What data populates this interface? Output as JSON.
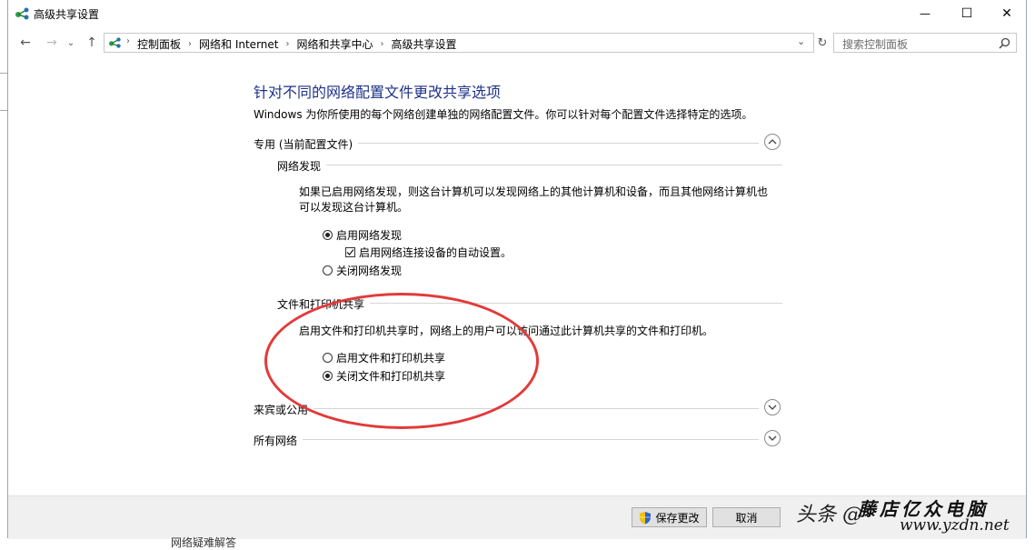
{
  "window": {
    "title": "高级共享设置",
    "minimize_glyph": "—",
    "maximize_glyph": "☐",
    "close_glyph": "✕"
  },
  "nav": {
    "back_glyph": "←",
    "forward_glyph": "→",
    "recent_glyph": "⌄",
    "up_glyph": "↑"
  },
  "address": {
    "crumbs": [
      "控制面板",
      "网络和 Internet",
      "网络和共享中心",
      "高级共享设置"
    ],
    "separator": "›"
  },
  "search": {
    "placeholder": "搜索控制面板"
  },
  "content": {
    "heading": "针对不同的网络配置文件更改共享选项",
    "description": "Windows 为你所使用的每个网络创建单独的网络配置文件。你可以针对每个配置文件选择特定的选项。",
    "sections": {
      "private": {
        "label": "专用 (当前配置文件)",
        "expanded": true,
        "network_discovery": {
          "label": "网络发现",
          "paragraph": "如果已启用网络发现，则这台计算机可以发现网络上的其他计算机和设备，而且其他网络计算机也可以发现这台计算机。",
          "options": {
            "on": "启用网络发现",
            "auto_setup": "启用网络连接设备的自动设置。",
            "off": "关闭网络发现"
          },
          "selected": "on",
          "auto_setup_checked": true
        },
        "file_printer_sharing": {
          "label": "文件和打印机共享",
          "paragraph": "启用文件和打印机共享时，网络上的用户可以访问通过此计算机共享的文件和打印机。",
          "options": {
            "on": "启用文件和打印机共享",
            "off": "关闭文件和打印机共享"
          },
          "selected": "off"
        }
      },
      "guest": {
        "label": "来宾或公用",
        "expanded": false
      },
      "all": {
        "label": "所有网络",
        "expanded": false
      }
    }
  },
  "footer": {
    "save_label": "保存更改",
    "cancel_label": "取消"
  },
  "background": {
    "below_text": "网络疑难解答"
  },
  "watermark": {
    "platform": "头条",
    "at": "@",
    "shop_name": "藤店亿众电脑",
    "url": "www.yzdn.net"
  },
  "colors": {
    "heading": "#1e3287",
    "annotation": "#e23a3a",
    "uac_shield_blue": "#2c62c9",
    "uac_shield_yellow": "#f2c100"
  }
}
